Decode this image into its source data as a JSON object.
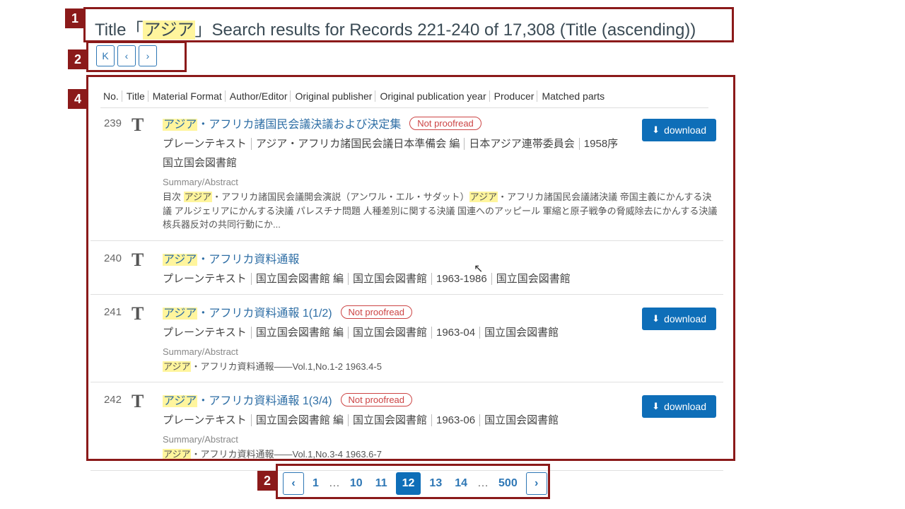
{
  "annotations": {
    "a1": "1",
    "a2": "2",
    "a4": "4",
    "a2b": "2"
  },
  "header": {
    "title_prefix": "Title「",
    "title_hl": "アジア",
    "title_suffix": "」Search results for Records 221-240 of 17,308 (Title (ascending))"
  },
  "nav": {
    "first": "K",
    "prev": "‹",
    "next": "›"
  },
  "columns": [
    "No.",
    "Title",
    "Material Format",
    "Author/Editor",
    "Original publisher",
    "Original publication year",
    "Producer",
    "Matched parts"
  ],
  "results": [
    {
      "no": "239",
      "title_hl": "アジア",
      "title_rest": "・アフリカ諸国民会議決議および決定集",
      "not_proofread": "Not proofread",
      "format": "プレーンテキスト",
      "author": "アジア・アフリカ諸国民会議日本準備会 編",
      "publisher": "日本アジア連帯委員会",
      "year": "1958序",
      "producer": "国立国会図書館",
      "summary_label": "Summary/Abstract",
      "summary_pre": "目次 ",
      "summary_hl1": "アジア",
      "summary_mid": "・アフリカ諸国民会議開会演説（アンワル・エル・サダット）",
      "summary_hl2": "アジア",
      "summary_post": "・アフリカ諸国民会議諸決議 帝国主義にかんする決議 アルジェリアにかんする決議 パレスチナ問題 人種差別に関する決議 国連へのアッピール 軍縮と原子戦争の脅威除去にかんする決議 核兵器反対の共同行動にか...",
      "download": "download"
    },
    {
      "no": "240",
      "title_hl": "アジア",
      "title_rest": "・アフリカ資料通報",
      "format": "プレーンテキスト",
      "author": "国立国会図書館 編",
      "publisher": "国立国会図書館",
      "year": "1963-1986",
      "producer": "国立国会図書館"
    },
    {
      "no": "241",
      "title_hl": "アジア",
      "title_rest": "・アフリカ資料通報 1(1/2)",
      "not_proofread": "Not proofread",
      "format": "プレーンテキスト",
      "author": "国立国会図書館 編",
      "publisher": "国立国会図書館",
      "year": "1963-04",
      "producer": "国立国会図書館",
      "summary_label": "Summary/Abstract",
      "summary_hl1": "アジア",
      "summary_post": "・アフリカ資料通報――Vol.1,No.1-2 1963.4-5",
      "download": "download"
    },
    {
      "no": "242",
      "title_hl": "アジア",
      "title_rest": "・アフリカ資料通報 1(3/4)",
      "not_proofread": "Not proofread",
      "format": "プレーンテキスト",
      "author": "国立国会図書館 編",
      "publisher": "国立国会図書館",
      "year": "1963-06",
      "producer": "国立国会図書館",
      "summary_label": "Summary/Abstract",
      "summary_hl1": "アジア",
      "summary_post": "・アフリカ資料通報――Vol.1,No.3-4 1963.6-7",
      "download": "download"
    }
  ],
  "pagination": {
    "prev": "‹",
    "pages": [
      "1",
      "…",
      "10",
      "11",
      "12",
      "13",
      "14",
      "…",
      "500"
    ],
    "active": "12",
    "next": "›"
  }
}
